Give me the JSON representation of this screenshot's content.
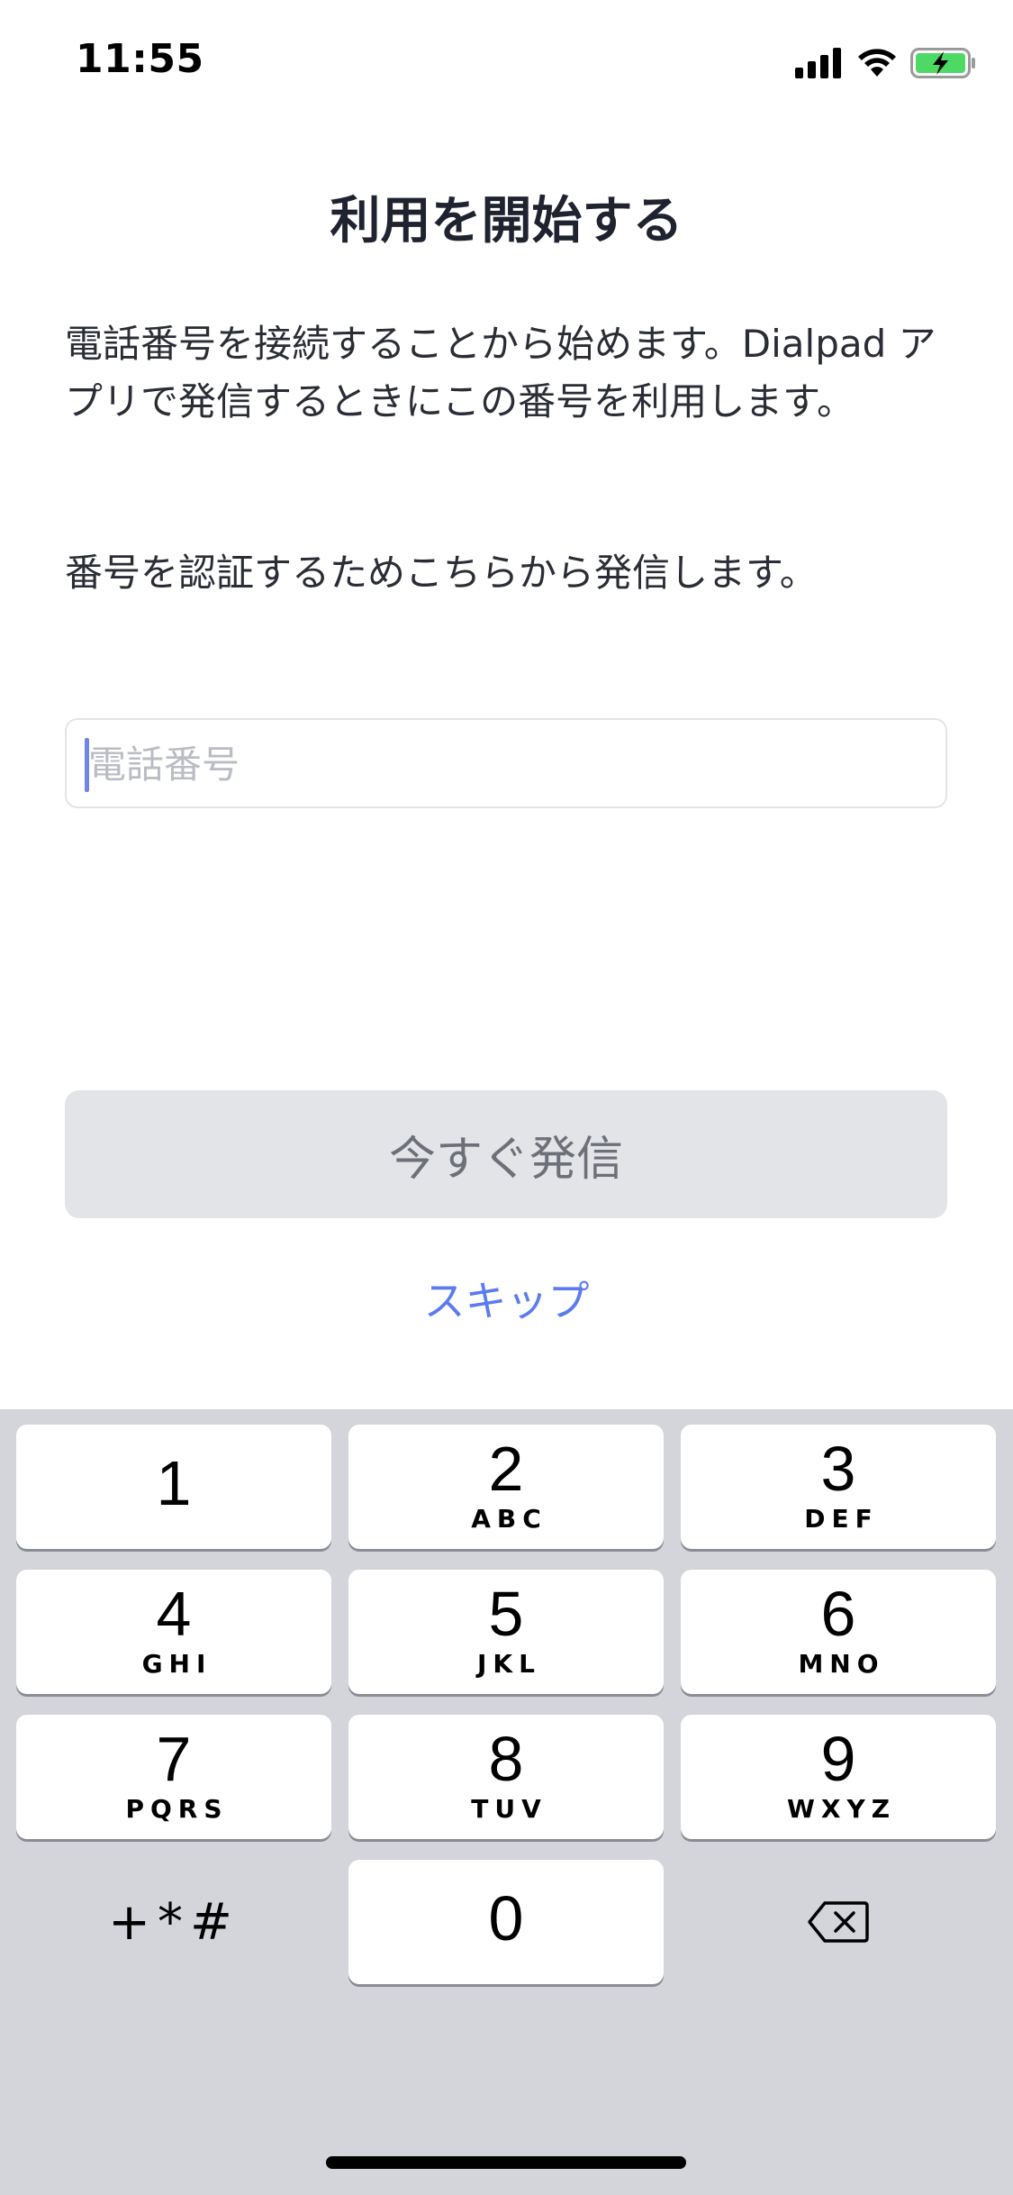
{
  "status_bar": {
    "time": "11:55",
    "icons": [
      "cellular-signal-icon",
      "wifi-icon",
      "battery-charging-icon"
    ],
    "battery_color": "#4cd964"
  },
  "title": "利用を開始する",
  "intro": "電話番号を接続することから始めます。Dialpad アプリで発信するときにこの番号を利用します。",
  "verify": "番号を認証するためこちらから発信します。",
  "phone_input": {
    "placeholder": "電話番号",
    "value": ""
  },
  "call_button": {
    "label": "今すぐ発信"
  },
  "skip": {
    "label": "スキップ"
  },
  "keypad": {
    "keys": [
      {
        "digit": "1",
        "letters": ""
      },
      {
        "digit": "2",
        "letters": "ABC"
      },
      {
        "digit": "3",
        "letters": "DEF"
      },
      {
        "digit": "4",
        "letters": "GHI"
      },
      {
        "digit": "5",
        "letters": "JKL"
      },
      {
        "digit": "6",
        "letters": "MNO"
      },
      {
        "digit": "7",
        "letters": "PQRS"
      },
      {
        "digit": "8",
        "letters": "TUV"
      },
      {
        "digit": "9",
        "letters": "WXYZ"
      },
      {
        "digit": "0",
        "letters": ""
      }
    ],
    "symbols": "+*#",
    "delete_icon": "backspace-icon"
  },
  "colors": {
    "accent": "#5b7cf0",
    "button_disabled_bg": "#e3e4e8",
    "keypad_bg": "#d3d5db"
  }
}
